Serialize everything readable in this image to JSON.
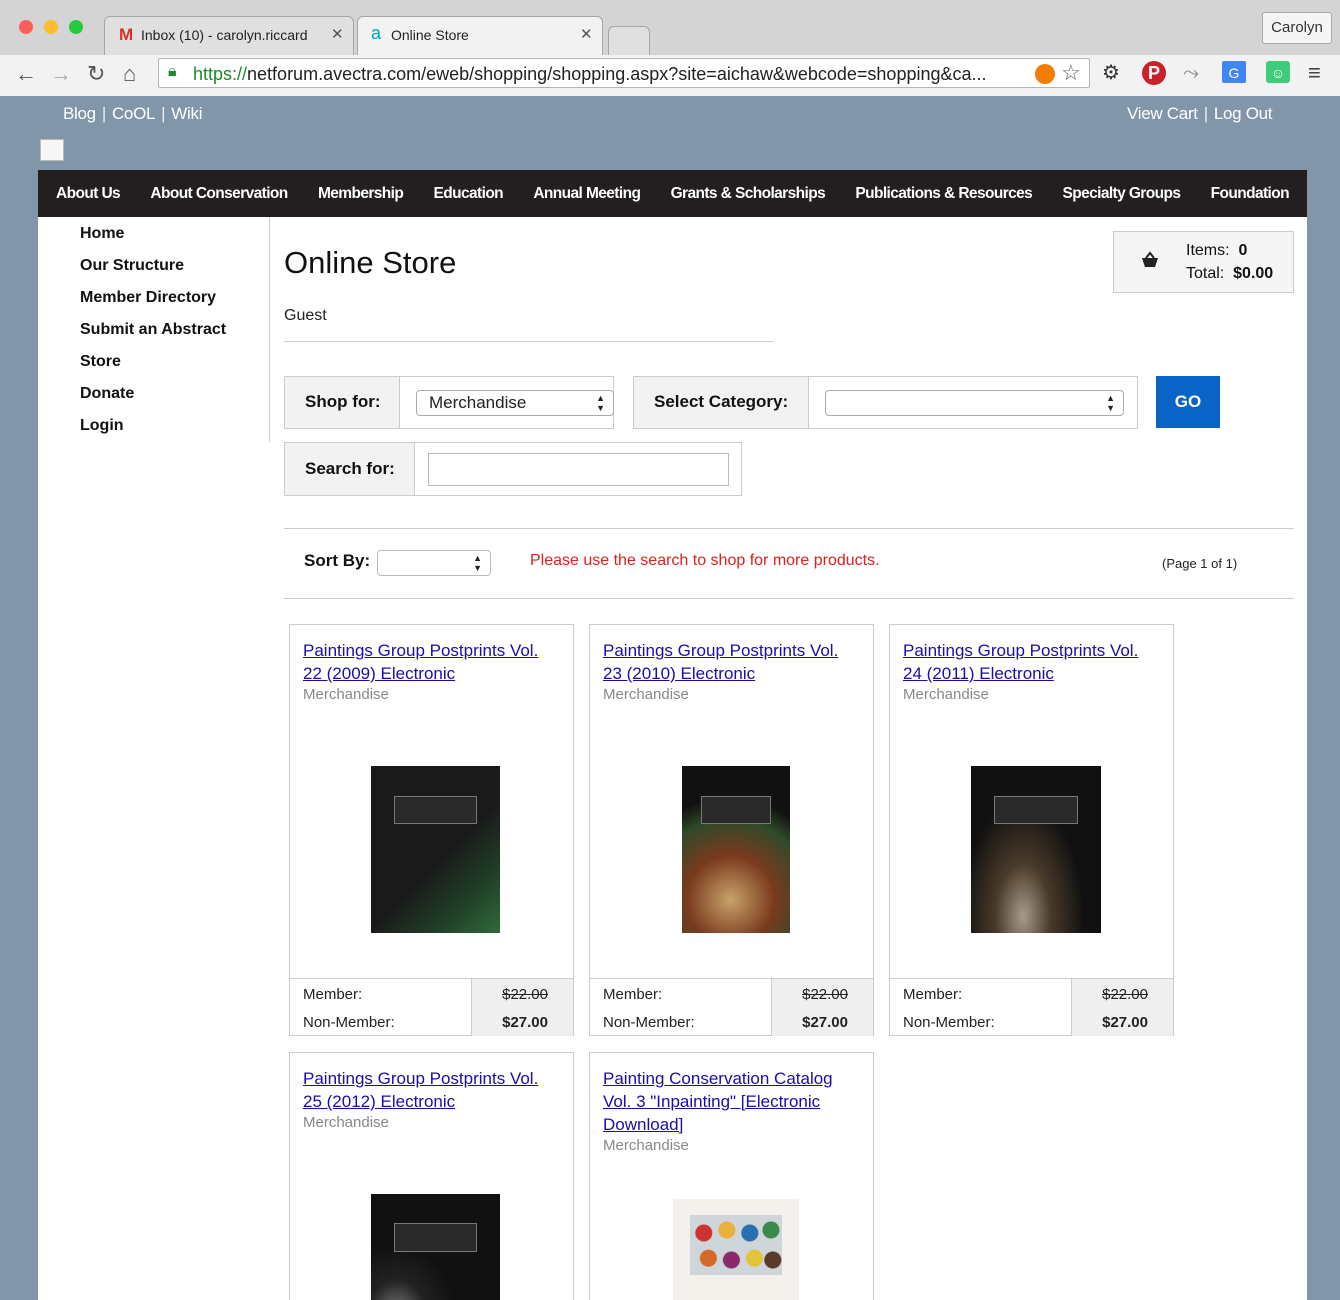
{
  "browser": {
    "tabs": [
      {
        "label": "Inbox (10) - carolyn.riccard"
      },
      {
        "label": "Online Store"
      }
    ],
    "user_label": "Carolyn",
    "url_scheme": "https://",
    "url_rest": "netforum.avectra.com/eweb/shopping/shopping.aspx?site=aichaw&webcode=shopping&ca..."
  },
  "top_links": {
    "left": [
      "Blog",
      "CoOL",
      "Wiki"
    ],
    "right": [
      "View Cart",
      "Log Out"
    ]
  },
  "main_nav": [
    "About Us",
    "About Conservation",
    "Membership",
    "Education",
    "Annual Meeting",
    "Grants & Scholarships",
    "Publications & Resources",
    "Specialty Groups",
    "Foundation"
  ],
  "side_nav": [
    "Home",
    "Our Structure",
    "Member Directory",
    "Submit an Abstract",
    "Store",
    "Donate",
    "Login"
  ],
  "page": {
    "title": "Online Store",
    "user": "Guest"
  },
  "cart": {
    "items_label": "Items:",
    "items_value": "0",
    "total_label": "Total:",
    "total_value": "$0.00"
  },
  "filters": {
    "shop_for_label": "Shop for:",
    "shop_for_value": "Merchandise",
    "category_label": "Select Category:",
    "category_value": "",
    "go_label": "GO",
    "search_label": "Search for:",
    "search_value": ""
  },
  "sort": {
    "label": "Sort By:",
    "value": "",
    "note": "Please use the search to shop for more products.",
    "page_info": "(Page 1 of 1)"
  },
  "products": [
    {
      "title": "Paintings Group Postprints Vol. 22 (2009) Electronic",
      "category": "Merchandise",
      "member_label": "Member:",
      "member_price": "$22.00",
      "nonmember_label": "Non-Member:",
      "nonmember_price": "$27.00"
    },
    {
      "title": "Paintings Group Postprints Vol. 23 (2010) Electronic",
      "category": "Merchandise",
      "member_label": "Member:",
      "member_price": "$22.00",
      "nonmember_label": "Non-Member:",
      "nonmember_price": "$27.00"
    },
    {
      "title": "Paintings Group Postprints Vol. 24 (2011) Electronic",
      "category": "Merchandise",
      "member_label": "Member:",
      "member_price": "$22.00",
      "nonmember_label": "Non-Member:",
      "nonmember_price": "$27.00"
    },
    {
      "title": "Paintings Group Postprints Vol. 25 (2012) Electronic",
      "category": "Merchandise"
    },
    {
      "title": "Painting Conservation Catalog Vol. 3 \"Inpainting\" [Electronic Download]",
      "category": "Merchandise"
    }
  ],
  "colors": {
    "page_bg": "#8196a8",
    "nav_bg": "#231f20",
    "go_button": "#0a63c6",
    "notice_red": "#e0201b",
    "link_blue": "#1a0dab"
  }
}
